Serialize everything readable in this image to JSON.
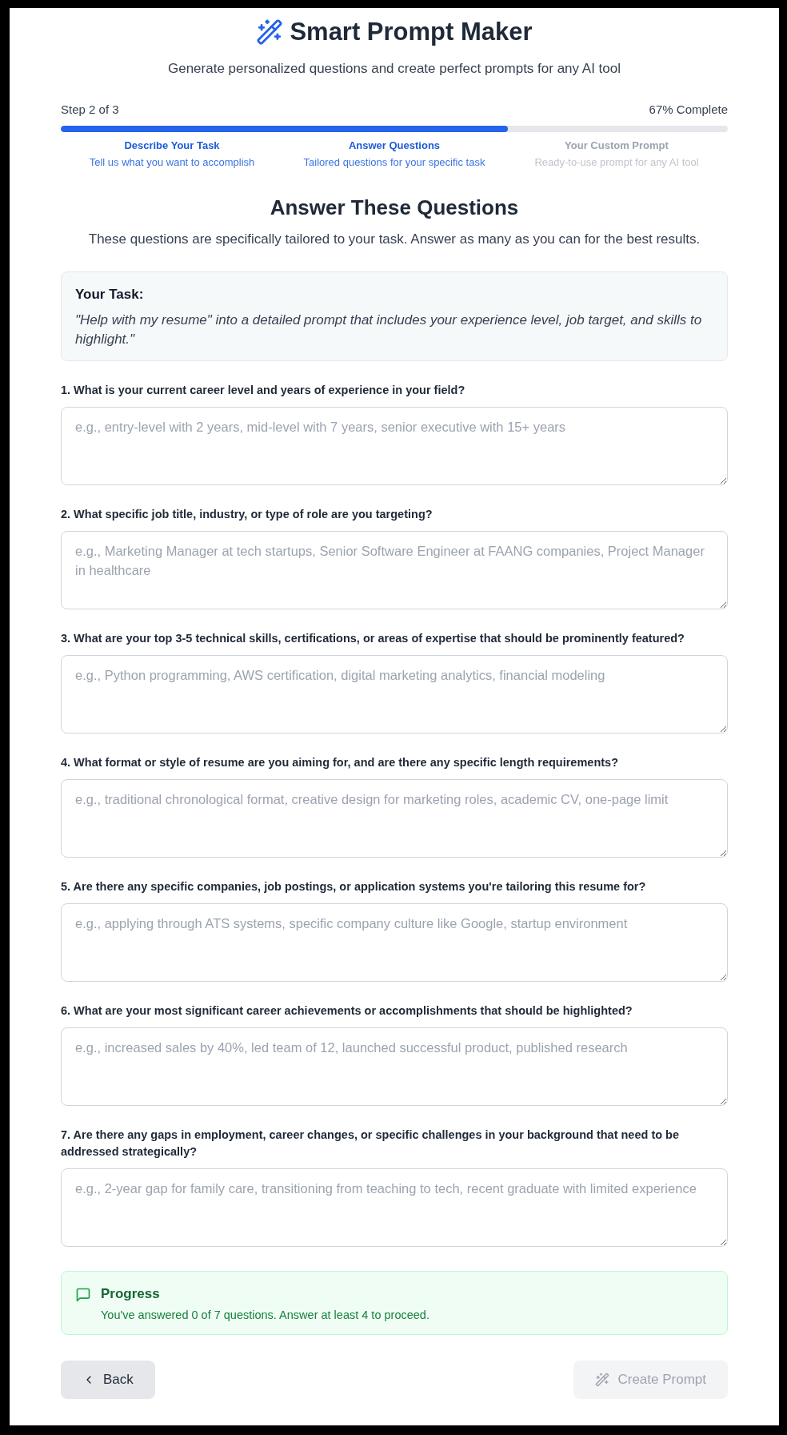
{
  "header": {
    "title": "Smart Prompt Maker",
    "subtitle": "Generate personalized questions and create perfect prompts for any AI tool"
  },
  "progress": {
    "step_label": "Step 2 of 3",
    "percent_label": "67% Complete",
    "level": 0.67
  },
  "steps": [
    {
      "title": "Describe Your Task",
      "caption": "Tell us what you want to accomplish",
      "active": true
    },
    {
      "title": "Answer Questions",
      "caption": "Tailored questions for your specific task",
      "active": true
    },
    {
      "title": "Your Custom Prompt",
      "caption": "Ready-to-use prompt for any AI tool",
      "active": false
    }
  ],
  "section": {
    "heading": "Answer These Questions",
    "description": "These questions are specifically tailored to your task. Answer as many as you can for the best results."
  },
  "task": {
    "label": "Your Task:",
    "text": "\"Help with my resume\" into a detailed prompt that includes your experience level, job target, and skills to highlight.\""
  },
  "questions": [
    {
      "label": "1. What is your current career level and years of experience in your field?",
      "placeholder": "e.g., entry-level with 2 years, mid-level with 7 years, senior executive with 15+ years"
    },
    {
      "label": "2. What specific job title, industry, or type of role are you targeting?",
      "placeholder": "e.g., Marketing Manager at tech startups, Senior Software Engineer at FAANG companies, Project Manager in healthcare"
    },
    {
      "label": "3. What are your top 3-5 technical skills, certifications, or areas of expertise that should be prominently featured?",
      "placeholder": "e.g., Python programming, AWS certification, digital marketing analytics, financial modeling"
    },
    {
      "label": "4. What format or style of resume are you aiming for, and are there any specific length requirements?",
      "placeholder": "e.g., traditional chronological format, creative design for marketing roles, academic CV, one-page limit"
    },
    {
      "label": "5. Are there any specific companies, job postings, or application systems you're tailoring this resume for?",
      "placeholder": "e.g., applying through ATS systems, specific company culture like Google, startup environment"
    },
    {
      "label": "6. What are your most significant career achievements or accomplishments that should be highlighted?",
      "placeholder": "e.g., increased sales by 40%, led team of 12, launched successful product, published research"
    },
    {
      "label": "7. Are there any gaps in employment, career changes, or specific challenges in your background that need to be addressed strategically?",
      "placeholder": "e.g., 2-year gap for family care, transitioning from teaching to tech, recent graduate with limited experience"
    }
  ],
  "status": {
    "title": "Progress",
    "message": "You've answered 0 of 7 questions. Answer at least 4 to proceed."
  },
  "buttons": [
    {
      "kind": "back",
      "label": "Back",
      "disabled": false
    },
    {
      "kind": "create",
      "label": "Create Prompt",
      "disabled": true
    }
  ]
}
